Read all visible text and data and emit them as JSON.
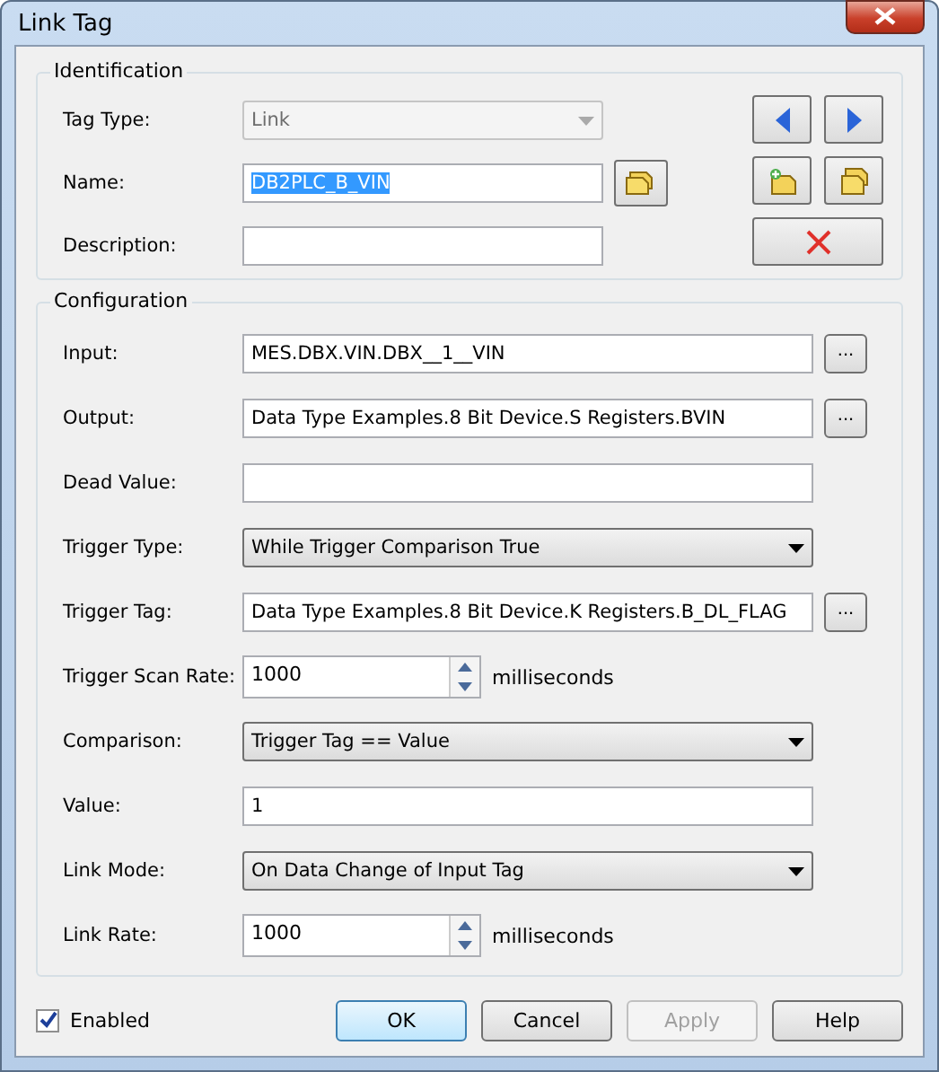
{
  "window": {
    "title": "Link Tag"
  },
  "identification": {
    "title": "Identification",
    "tag_type": {
      "label": "Tag Type:",
      "value": "Link",
      "disabled": true
    },
    "name": {
      "label": "Name:",
      "value": "DB2PLC_B_VIN",
      "text_selected": true
    },
    "description": {
      "label": "Description:"
    }
  },
  "configuration": {
    "title": "Configuration",
    "rows": [
      {
        "kind": "browse",
        "label": "Input:",
        "value": "MES.DBX.VIN.DBX__1__VIN",
        "button": "..."
      },
      {
        "kind": "browse",
        "label": "Output:",
        "value": "Data Type Examples.8 Bit Device.S Registers.BVIN",
        "button": "..."
      },
      {
        "kind": "text",
        "label": "Dead Value:"
      },
      {
        "kind": "dropdown",
        "label": "Trigger Type:",
        "value": "While Trigger Comparison True"
      },
      {
        "kind": "browse",
        "label": "Trigger Tag:",
        "value": "Data Type Examples.8 Bit Device.K Registers.B_DL_FLAG",
        "button": "..."
      },
      {
        "kind": "spin",
        "label": "Trigger Scan Rate:",
        "value": "1000",
        "unit": "milliseconds"
      },
      {
        "kind": "dropdown",
        "label": "Comparison:",
        "value": "Trigger Tag == Value"
      },
      {
        "kind": "text",
        "label": "Value:",
        "value": "1"
      },
      {
        "kind": "dropdown",
        "label": "Link Mode:",
        "value": "On Data Change of Input Tag"
      },
      {
        "kind": "spin",
        "label": "Link Rate:",
        "value": "1000",
        "unit": "milliseconds"
      }
    ]
  },
  "enabled": {
    "label": "Enabled",
    "checked": true
  },
  "buttons": [
    {
      "label": "OK",
      "default": true,
      "disabled": false
    },
    {
      "label": "Cancel",
      "default": false,
      "disabled": false
    },
    {
      "label": "Apply",
      "default": false,
      "disabled": true
    },
    {
      "label": "Help",
      "default": false,
      "disabled": false
    }
  ]
}
